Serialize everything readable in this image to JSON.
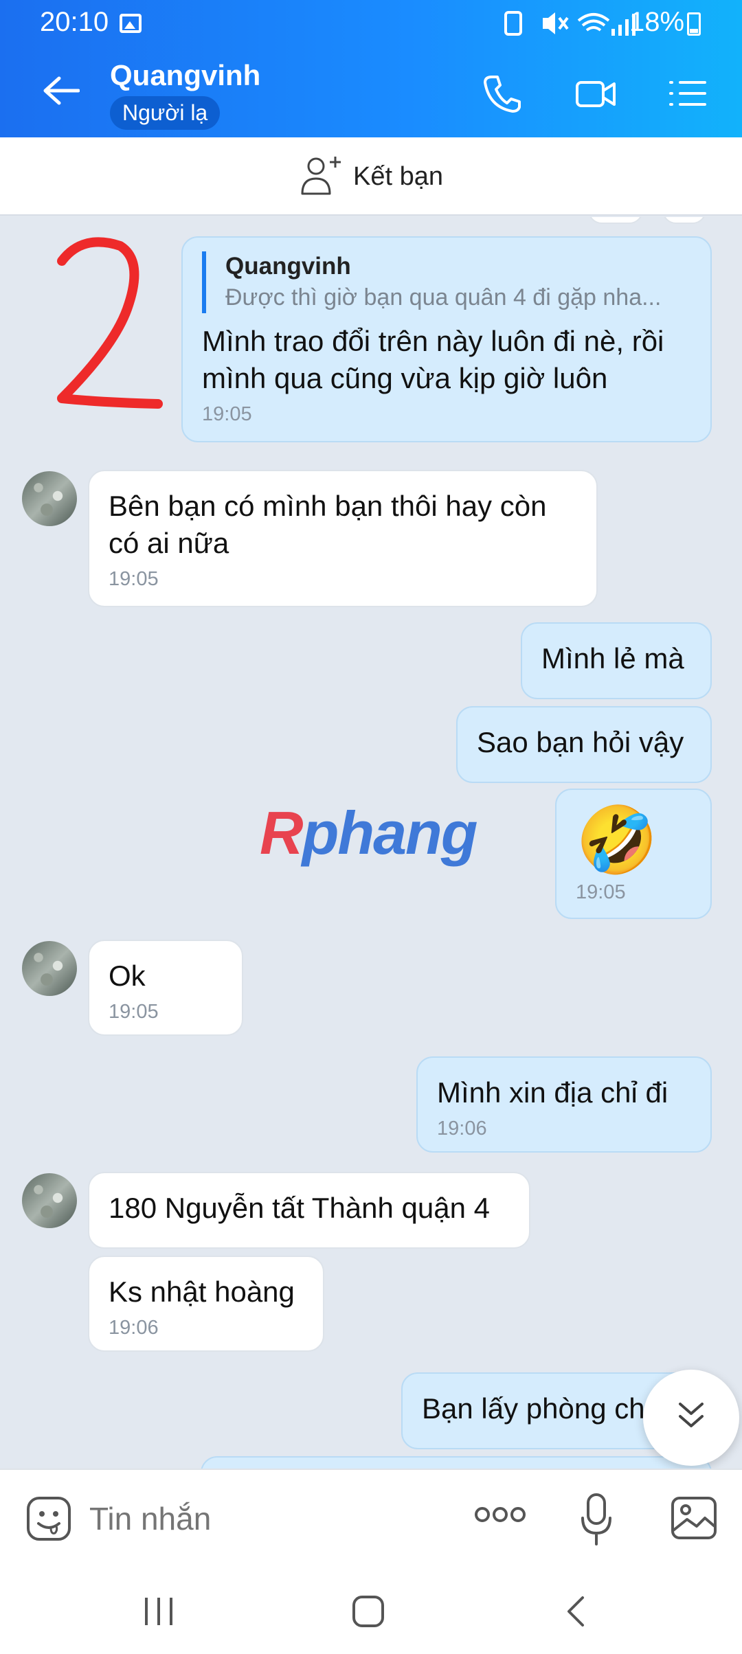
{
  "status": {
    "time": "20:10",
    "battery": "18%"
  },
  "header": {
    "title": "Quangvinh",
    "subtitle": "Người lạ"
  },
  "friend_bar": {
    "label": "Kết bạn"
  },
  "watermark": {
    "part1": "R",
    "part2": "phang"
  },
  "messages": [
    {
      "side": "out",
      "quote": {
        "name": "Quangvinh",
        "text": "Được thì giờ bạn qua quân 4 đi gặp nha..."
      },
      "text": "Mình trao đổi trên này luôn đi nè, rồi mình qua cũng vừa kịp giờ luôn",
      "time": "19:05"
    },
    {
      "side": "in",
      "text": "Bên bạn có mình bạn thôi hay còn có ai nữa",
      "time": "19:05"
    },
    {
      "side": "out",
      "text": "Mình lẻ mà"
    },
    {
      "side": "out",
      "text": "Sao bạn hỏi vậy"
    },
    {
      "side": "out",
      "text": "🤣",
      "time": "19:05"
    },
    {
      "side": "in",
      "text": "Ok",
      "time": "19:05"
    },
    {
      "side": "out",
      "text": "Mình xin địa chỉ đi",
      "time": "19:06"
    },
    {
      "side": "in",
      "text": "180 Nguyễn tất Thành quận 4"
    },
    {
      "side": "in",
      "text": "Ks nhật hoàng",
      "time": "19:06"
    },
    {
      "side": "out",
      "text": "Bạn lấy phòng chưa"
    }
  ],
  "input": {
    "placeholder": "Tin nhắn"
  }
}
